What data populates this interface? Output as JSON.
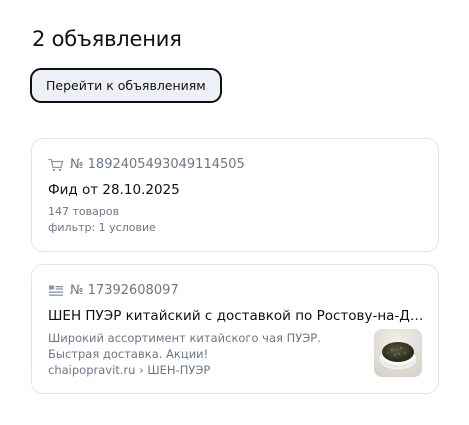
{
  "header": {
    "title": "2 объявления",
    "goto_button_label": "Перейти к объявлениям"
  },
  "cards": [
    {
      "icon": "cart-icon",
      "number": "№ 1892405493049114505",
      "title": "Фид от 28.10.2025",
      "products": "147 товаров",
      "filter": "фильтр: 1 условие"
    },
    {
      "icon": "text-ad-icon",
      "number": "№ 17392608097",
      "title": "ШЕН ПУЭР китайский с доставкой по Ростову-на-Дону!...",
      "description": "Широкий ассортимент китайского чая ПУЭР. Быстрая доставка. Акции!",
      "breadcrumb": "chaipopravit.ru › ШЕН-ПУЭР",
      "image": "tea-bowl-image"
    }
  ],
  "colors": {
    "button_bg": "#eef0f7",
    "meta_text": "#6b7688",
    "card_border": "#e3e5ea"
  }
}
